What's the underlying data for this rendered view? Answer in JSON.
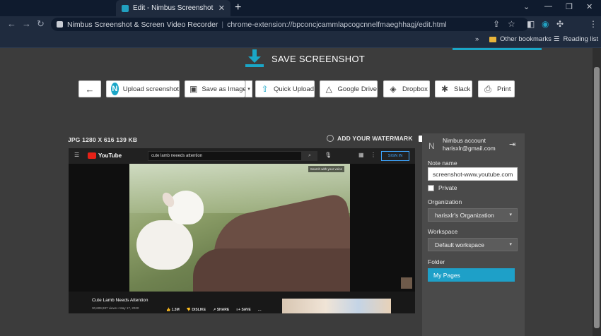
{
  "browser": {
    "tab_title": "Edit - Nimbus Screenshot",
    "tab_close": "✕",
    "new_tab": "+",
    "window_controls": [
      "⌄",
      "—",
      "❐",
      "✕"
    ],
    "omnibox_site": "Nimbus Screenshot & Screen Video Recorder",
    "omnibox_sep": "|",
    "omnibox_url": "chrome-extension://bpconcjcammlapcogcnnelfmaeghhagj/edit.html",
    "bookmarks_more": "»",
    "other_bookmarks": "Other bookmarks",
    "reading_list": "Reading list"
  },
  "header": {
    "title": "SAVE SCREENSHOT"
  },
  "actions": {
    "back_icon": "←",
    "upload_screenshot": "Upload screenshot",
    "save_as_image": "Save as Image",
    "save_caret": "▾",
    "quick_upload": "Quick Upload",
    "google_drive": "Google Drive",
    "dropbox": "Dropbox",
    "slack": "Slack",
    "print": "Print"
  },
  "preview": {
    "meta": "JPG 1280 X 616 139 KB",
    "watermark_label": "ADD YOUR WATERMARK",
    "youtube": {
      "logo": "YouTube",
      "search_value": "cute lamb neeeds attention",
      "signin": "SIGN IN",
      "hint": "Search with your voice",
      "title": "Cute Lamb Needs Attention",
      "views": "30,609,937 views • May 17, 2020",
      "likes": "1.3M",
      "dislike": "DISLIKE",
      "share": "SHARE",
      "save": "SAVE",
      "more": "…"
    }
  },
  "sidebar": {
    "account_label": "Nimbus account",
    "account_email": "harisxlr@gmail.com",
    "note_name_label": "Note name",
    "note_name_value": "screenshot-www.youtube.com",
    "private_label": "Private",
    "organization_label": "Organization",
    "organization_value": "harisxlr's Organization",
    "workspace_label": "Workspace",
    "workspace_value": "Default workspace",
    "folder_label": "Folder",
    "folder_value": "My Pages",
    "caret": "▾"
  },
  "colors": {
    "accent": "#1aa6c7",
    "page_bg": "#3c3c3c",
    "chrome_dark": "#0f1b2e"
  }
}
